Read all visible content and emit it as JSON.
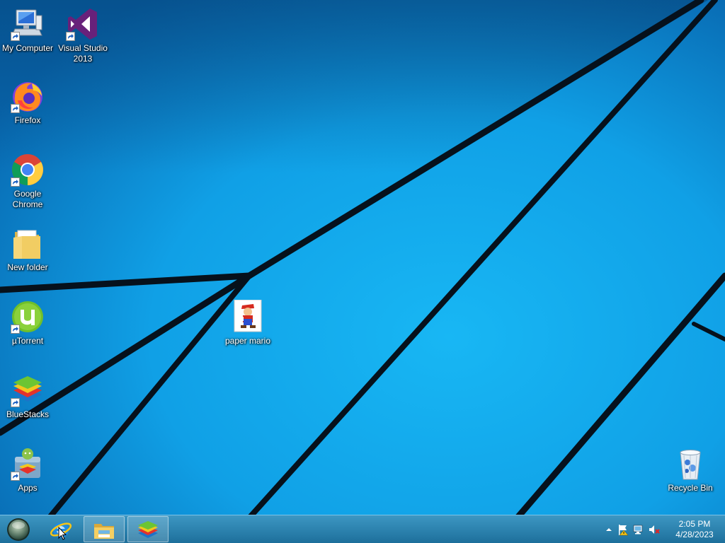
{
  "desktop": {
    "icons": [
      {
        "label": "My Computer",
        "icon": "computer-icon"
      },
      {
        "label": "Visual Studio 2013",
        "icon": "visual-studio-icon"
      },
      {
        "label": "Firefox",
        "icon": "firefox-icon"
      },
      {
        "label": "Google Chrome",
        "icon": "chrome-icon"
      },
      {
        "label": "New folder",
        "icon": "folder-icon"
      },
      {
        "label": "µTorrent",
        "icon": "utorrent-icon"
      },
      {
        "label": "BlueStacks",
        "icon": "bluestacks-icon"
      },
      {
        "label": "Apps",
        "icon": "apps-icon"
      },
      {
        "label": "paper mario",
        "icon": "paper-mario-icon"
      },
      {
        "label": "Recycle Bin",
        "icon": "recycle-bin-icon"
      }
    ]
  },
  "taskbar": {
    "start_icon": "start-orb-icon",
    "pinned": [
      "internet-explorer-icon",
      "file-explorer-icon",
      "bluestacks-icon"
    ],
    "tray": [
      "show-hidden-icons-icon",
      "action-center-flag-icon",
      "network-icon",
      "volume-muted-icon"
    ],
    "clock": {
      "time": "2:05 PM",
      "date": "4/28/2023"
    }
  },
  "colors": {
    "wallpaper_light": "#1aa6e6",
    "wallpaper_dark": "#0a5ea0",
    "taskbar": "#2a7fae"
  }
}
